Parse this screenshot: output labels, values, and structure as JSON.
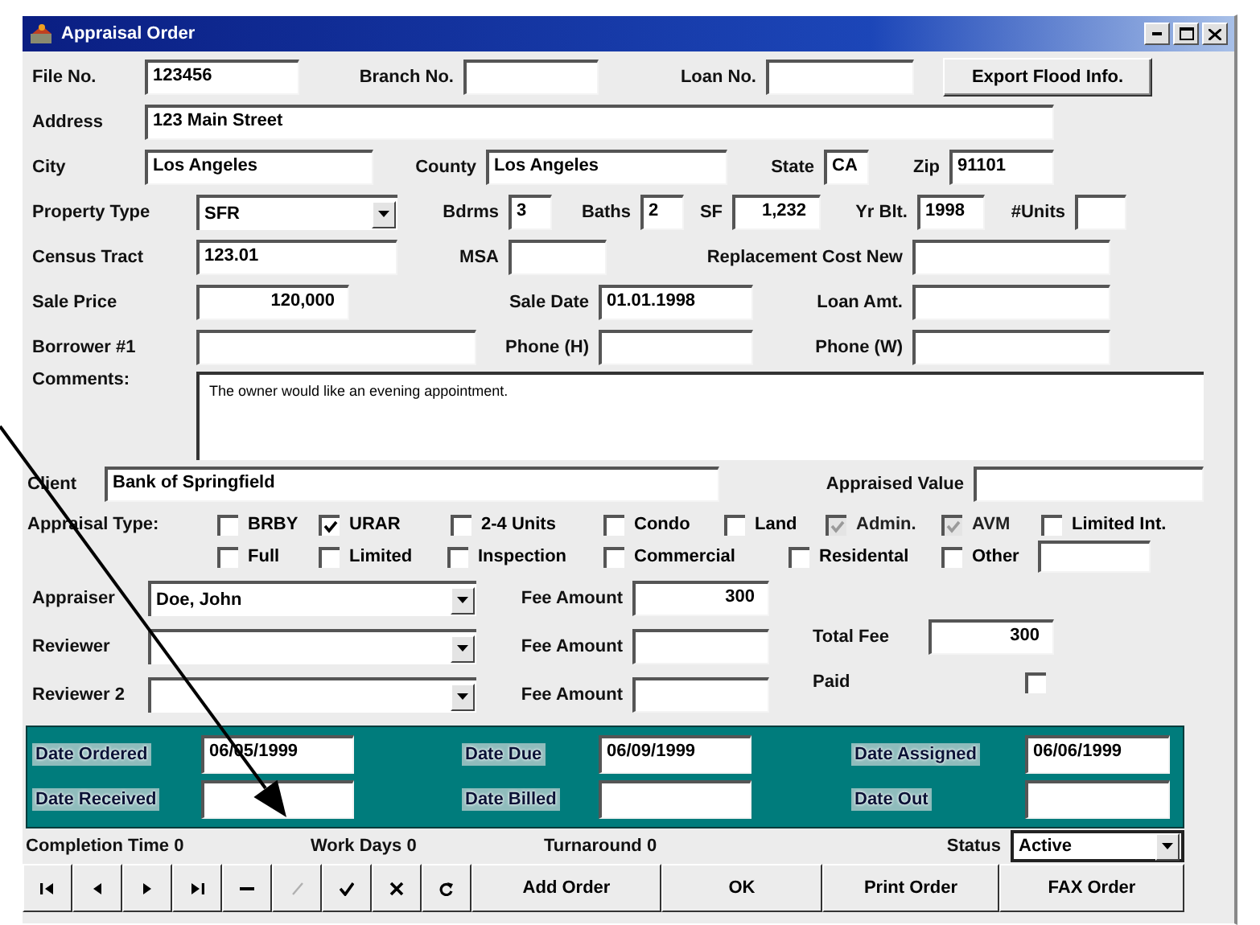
{
  "window": {
    "title": "Appraisal Order"
  },
  "form_rows": [
    {
      "items": [
        {
          "kind": "label",
          "text": "File No."
        },
        {
          "kind": "field",
          "value": "123456"
        },
        {
          "kind": "label",
          "text": "Branch No."
        },
        {
          "kind": "field"
        },
        {
          "kind": "label",
          "text": "Loan No."
        },
        {
          "kind": "field"
        },
        {
          "kind": "button",
          "text": "Export Flood Info."
        }
      ]
    },
    {
      "items": [
        {
          "kind": "label",
          "text": "Address"
        },
        {
          "kind": "field",
          "value": "123 Main Street"
        }
      ]
    },
    {
      "items": [
        {
          "kind": "label",
          "text": "City"
        },
        {
          "kind": "field",
          "value": "Los Angeles"
        },
        {
          "kind": "label",
          "text": "County"
        },
        {
          "kind": "field",
          "value": "Los Angeles"
        },
        {
          "kind": "label",
          "text": "State"
        },
        {
          "kind": "field",
          "value": "CA"
        },
        {
          "kind": "label",
          "text": "Zip"
        },
        {
          "kind": "field",
          "value": "91101"
        }
      ]
    },
    {
      "items": [
        {
          "kind": "label",
          "text": "Property Type"
        },
        {
          "kind": "select",
          "value": "SFR"
        },
        {
          "kind": "label",
          "text": "Bdrms"
        },
        {
          "kind": "field",
          "value": "3"
        },
        {
          "kind": "label",
          "text": "Baths"
        },
        {
          "kind": "field",
          "value": "2"
        },
        {
          "kind": "label",
          "text": "SF"
        },
        {
          "kind": "number",
          "value": "1,232"
        },
        {
          "kind": "label",
          "text": "Yr Blt."
        },
        {
          "kind": "field",
          "value": "1998"
        },
        {
          "kind": "label",
          "text": "#Units"
        },
        {
          "kind": "field"
        }
      ]
    },
    {
      "items": [
        {
          "kind": "label",
          "text": "Census Tract"
        },
        {
          "kind": "field",
          "value": "123.01"
        },
        {
          "kind": "label",
          "text": "MSA"
        },
        {
          "kind": "field"
        },
        {
          "kind": "label",
          "text": "Replacement Cost New"
        },
        {
          "kind": "field"
        }
      ]
    },
    {
      "items": [
        {
          "kind": "label",
          "text": "Sale Price"
        },
        {
          "kind": "number",
          "value": "120,000"
        },
        {
          "kind": "label",
          "text": "Sale Date"
        },
        {
          "kind": "field",
          "value": "01.01.1998"
        },
        {
          "kind": "label",
          "text": "Loan Amt."
        },
        {
          "kind": "field"
        }
      ]
    },
    {
      "items": [
        {
          "kind": "label",
          "text": "Borrower #1"
        },
        {
          "kind": "field"
        },
        {
          "kind": "label",
          "text": "Phone (H)"
        },
        {
          "kind": "field"
        },
        {
          "kind": "label",
          "text": "Phone (W)"
        },
        {
          "kind": "field"
        }
      ]
    },
    {
      "items": [
        {
          "kind": "label",
          "text": "Comments:"
        },
        {
          "kind": "memo",
          "value": "The owner would like an evening appointment."
        }
      ]
    },
    {
      "items": [
        {
          "kind": "label",
          "text": "Client"
        },
        {
          "kind": "field",
          "value": "Bank of Springfield"
        },
        {
          "kind": "label",
          "text": "Appraised Value"
        },
        {
          "kind": "field"
        }
      ]
    }
  ],
  "appraisal_type": {
    "label": "Appraisal Type:",
    "options": [
      {
        "label": "BRBY",
        "checked": false,
        "disabled": false
      },
      {
        "label": "URAR",
        "checked": true,
        "disabled": false
      },
      {
        "label": "2-4 Units",
        "checked": false,
        "disabled": false
      },
      {
        "label": "Condo",
        "checked": false,
        "disabled": false
      },
      {
        "label": "Land",
        "checked": false,
        "disabled": false
      },
      {
        "label": "Admin.",
        "checked": true,
        "disabled": true
      },
      {
        "label": "AVM",
        "checked": true,
        "disabled": true
      },
      {
        "label": "Limited Int.",
        "checked": false,
        "disabled": false
      },
      {
        "label": "Full",
        "checked": false,
        "disabled": false
      },
      {
        "label": "Limited",
        "checked": false,
        "disabled": false
      },
      {
        "label": "Inspection",
        "checked": false,
        "disabled": false
      },
      {
        "label": "Commercial",
        "checked": false,
        "disabled": false
      },
      {
        "label": "Residental",
        "checked": false,
        "disabled": false
      },
      {
        "label": "Other",
        "checked": false,
        "disabled": false
      }
    ]
  },
  "staff": [
    {
      "label": "Appraiser",
      "value": "Doe, John",
      "fee_label": "Fee Amount",
      "fee": "300"
    },
    {
      "label": "Reviewer",
      "fee_label": "Fee Amount"
    },
    {
      "label": "Reviewer 2",
      "fee_label": "Fee Amount"
    }
  ],
  "total_fee": {
    "label": "Total Fee",
    "value": "300"
  },
  "paid": {
    "label": "Paid",
    "checked": false
  },
  "dates": [
    [
      {
        "label": "Date Ordered",
        "value": "06/05/1999"
      },
      {
        "label": "Date Due",
        "value": "06/09/1999"
      },
      {
        "label": "Date Assigned",
        "value": "06/06/1999"
      }
    ],
    [
      {
        "label": "Date Received"
      },
      {
        "label": "Date Billed"
      },
      {
        "label": "Date Out"
      }
    ]
  ],
  "stats": [
    "Completion Time 0",
    "Work Days 0",
    "Turnaround 0"
  ],
  "status": {
    "label": "Status",
    "value": "Active"
  },
  "navigator": [
    {
      "kind": "first",
      "disabled": false
    },
    {
      "kind": "prior",
      "disabled": false
    },
    {
      "kind": "next",
      "disabled": false
    },
    {
      "kind": "last",
      "disabled": false
    },
    {
      "kind": "delete",
      "disabled": false
    },
    {
      "kind": "edit",
      "disabled": true
    },
    {
      "kind": "post",
      "disabled": false
    },
    {
      "kind": "cancel",
      "disabled": false
    },
    {
      "kind": "refresh",
      "disabled": false
    }
  ],
  "actions": [
    "Add Order",
    "OK",
    "Print Order",
    "FAX Order"
  ]
}
